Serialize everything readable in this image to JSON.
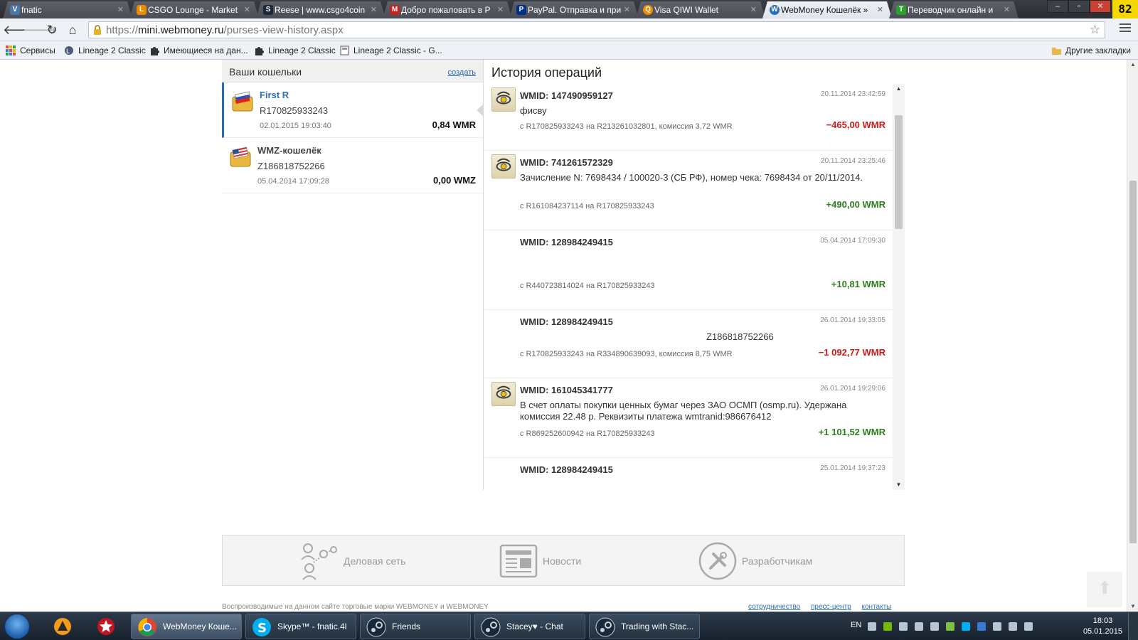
{
  "browser": {
    "tabs": [
      {
        "label": "fnatic",
        "icon": "vk-icon",
        "color": "#4a76a8"
      },
      {
        "label": "CSGO Lounge - Market",
        "icon": "lounge-icon",
        "color": "#e98b00"
      },
      {
        "label": "Reese | www.csgo4coin",
        "icon": "steam-icon",
        "color": "#1b2838"
      },
      {
        "label": "Добро пожаловать в Р",
        "icon": "gmail-icon",
        "color": "#c5221f"
      },
      {
        "label": "PayPal. Отправка и при",
        "icon": "paypal-icon",
        "color": "#003087"
      },
      {
        "label": "Visa QIWI Wallet",
        "icon": "qiwi-icon",
        "color": "#f28a00"
      },
      {
        "label": "WebMoney Кошелёк »",
        "icon": "webmoney-icon",
        "color": "#2a6eb5"
      },
      {
        "label": "Переводчик онлайн и",
        "icon": "translate-icon",
        "color": "#2e9f2e"
      }
    ],
    "active_tab": 6,
    "corner_badge": "82",
    "url_host": "mini.webmoney.ru",
    "url_scheme": "https://",
    "url_path": "/purses-view-history.aspx",
    "bookmarks": [
      {
        "label": "Сервисы",
        "icon": "apps-icon"
      },
      {
        "label": "Lineage 2 Classic",
        "icon": "l2-icon"
      },
      {
        "label": "Имеющиеся на дан...",
        "icon": "puzzle-icon"
      },
      {
        "label": "Lineage 2 Classic",
        "icon": "puzzle-icon"
      },
      {
        "label": "Lineage 2 Classic - G...",
        "icon": "page-icon"
      }
    ],
    "other_bookmarks": "Другие закладки"
  },
  "wallets": {
    "title": "Ваши кошельки",
    "create_label": "создать",
    "items": [
      {
        "name": "First R",
        "number": "R170825933243",
        "date": "02.01.2015 19:03:40",
        "balance": "0,84 WMR",
        "flag": "ru"
      },
      {
        "name": "WMZ-кошелёк",
        "number": "Z186818752266",
        "date": "05.04.2014 17:09:28",
        "balance": "0,00 WMZ",
        "flag": "us"
      }
    ]
  },
  "history": {
    "title": "История операций",
    "ops": [
      {
        "wmid": "WMID: 147490959127",
        "date": "20.11.2014 23:42:59",
        "desc": "фисву",
        "route": "с R170825933243 на R213261032801, комиссия 3,72 WMR",
        "amount": "−465,00 WMR",
        "sign": "neg"
      },
      {
        "wmid": "WMID: 741261572329",
        "date": "20.11.2014 23:25:46",
        "desc": "Зачисление N: 7698434 / 100020-3 (СБ РФ), номер чека: 7698434 от 20/11/2014.",
        "route": "с R161084237114 на R170825933243",
        "amount": "+490,00 WMR",
        "sign": "pos"
      },
      {
        "wmid": "WMID: 128984249415",
        "date": "05.04.2014 17:09:30",
        "desc": "",
        "route": "с R440723814024 на R170825933243",
        "amount": "+10,81 WMR",
        "sign": "pos"
      },
      {
        "wmid": "WMID: 128984249415",
        "date": "26.01.2014 19:33:05",
        "desc": "Z186818752266",
        "route": "с R170825933243 на R334890639093, комиссия 8,75 WMR",
        "amount": "−1 092,77 WMR",
        "sign": "neg"
      },
      {
        "wmid": "WMID: 161045341777",
        "date": "26.01.2014 19:29:06",
        "desc": "В счет оплаты покупки ценных бумаг через ЗАО ОСМП (osmp.ru). Удержана комиссия 22.48 р. Реквизиты платежа wmtranid:986676412",
        "route": "с R869252600942 на R170825933243",
        "amount": "+1 101,52 WMR",
        "sign": "pos"
      },
      {
        "wmid": "WMID: 128984249415",
        "date": "25.01.2014 19:37:23",
        "desc": "",
        "route": "",
        "amount": "",
        "sign": "neg"
      }
    ]
  },
  "footer": {
    "links": [
      {
        "label": "Деловая сеть",
        "icon": "network-icon"
      },
      {
        "label": "Новости",
        "icon": "news-icon"
      },
      {
        "label": "Разработчикам",
        "icon": "tools-icon"
      }
    ],
    "legal": "Воспроизводимые на данном сайте торговые марки WEBMONEY и WEBMONEY",
    "bottom_links": [
      "сотрудничество",
      "пресс-центр",
      "контакты"
    ]
  },
  "taskbar": {
    "buttons": [
      {
        "label": "WebMoney Коше...",
        "icon": "chrome-icon",
        "color": "#e04b3a"
      },
      {
        "label": "Skype™ - fnatic.4l",
        "icon": "skype-icon",
        "color": "#00aff0"
      },
      {
        "label": "Friends",
        "icon": "steam-icon",
        "color": "#1b2838"
      },
      {
        "label": "Stacey♥ - Chat",
        "icon": "steam-icon",
        "color": "#1b2838"
      },
      {
        "label": "Trading with Stac...",
        "icon": "steam-icon",
        "color": "#1b2838"
      }
    ],
    "lang": "EN",
    "time": "18:03",
    "date": "05.01.2015"
  }
}
